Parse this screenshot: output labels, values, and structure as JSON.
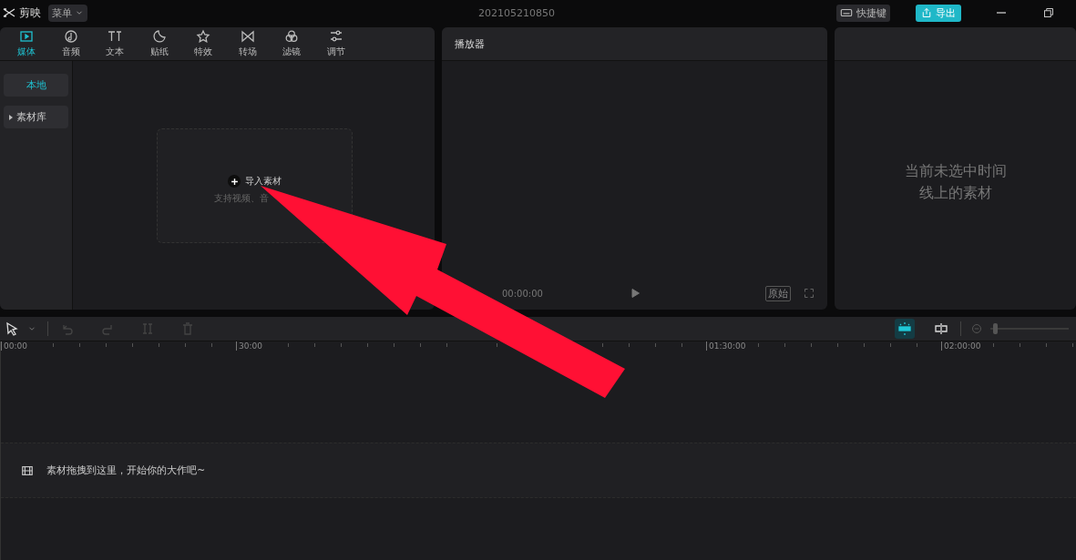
{
  "titlebar": {
    "app_name": "剪映",
    "menu": "菜单",
    "project": "202105210850",
    "shortcut": "快捷键",
    "export": "导出"
  },
  "tabs": [
    {
      "label": "媒体",
      "selected": true
    },
    {
      "label": "音频",
      "selected": false
    },
    {
      "label": "文本",
      "selected": false
    },
    {
      "label": "贴纸",
      "selected": false
    },
    {
      "label": "特效",
      "selected": false
    },
    {
      "label": "转场",
      "selected": false
    },
    {
      "label": "滤镜",
      "selected": false
    },
    {
      "label": "调节",
      "selected": false
    }
  ],
  "sidebar": [
    {
      "label": "本地",
      "selected": true,
      "kind": "item"
    },
    {
      "label": "素材库",
      "selected": false,
      "kind": "group"
    }
  ],
  "import": {
    "label": "导入素材",
    "hint": "支持视频、音"
  },
  "player": {
    "title": "播放器",
    "time": "00:00:00",
    "ratio": "原始"
  },
  "details": {
    "empty_text": "当前未选中时间线上的素材"
  },
  "timeline": {
    "zoom": {
      "level": 0.04
    },
    "ruler": [
      "00:00",
      "30:00",
      "01:30:00",
      "02:00:00"
    ],
    "drop_hint": "素材拖拽到这里，开始你的大作吧~"
  }
}
